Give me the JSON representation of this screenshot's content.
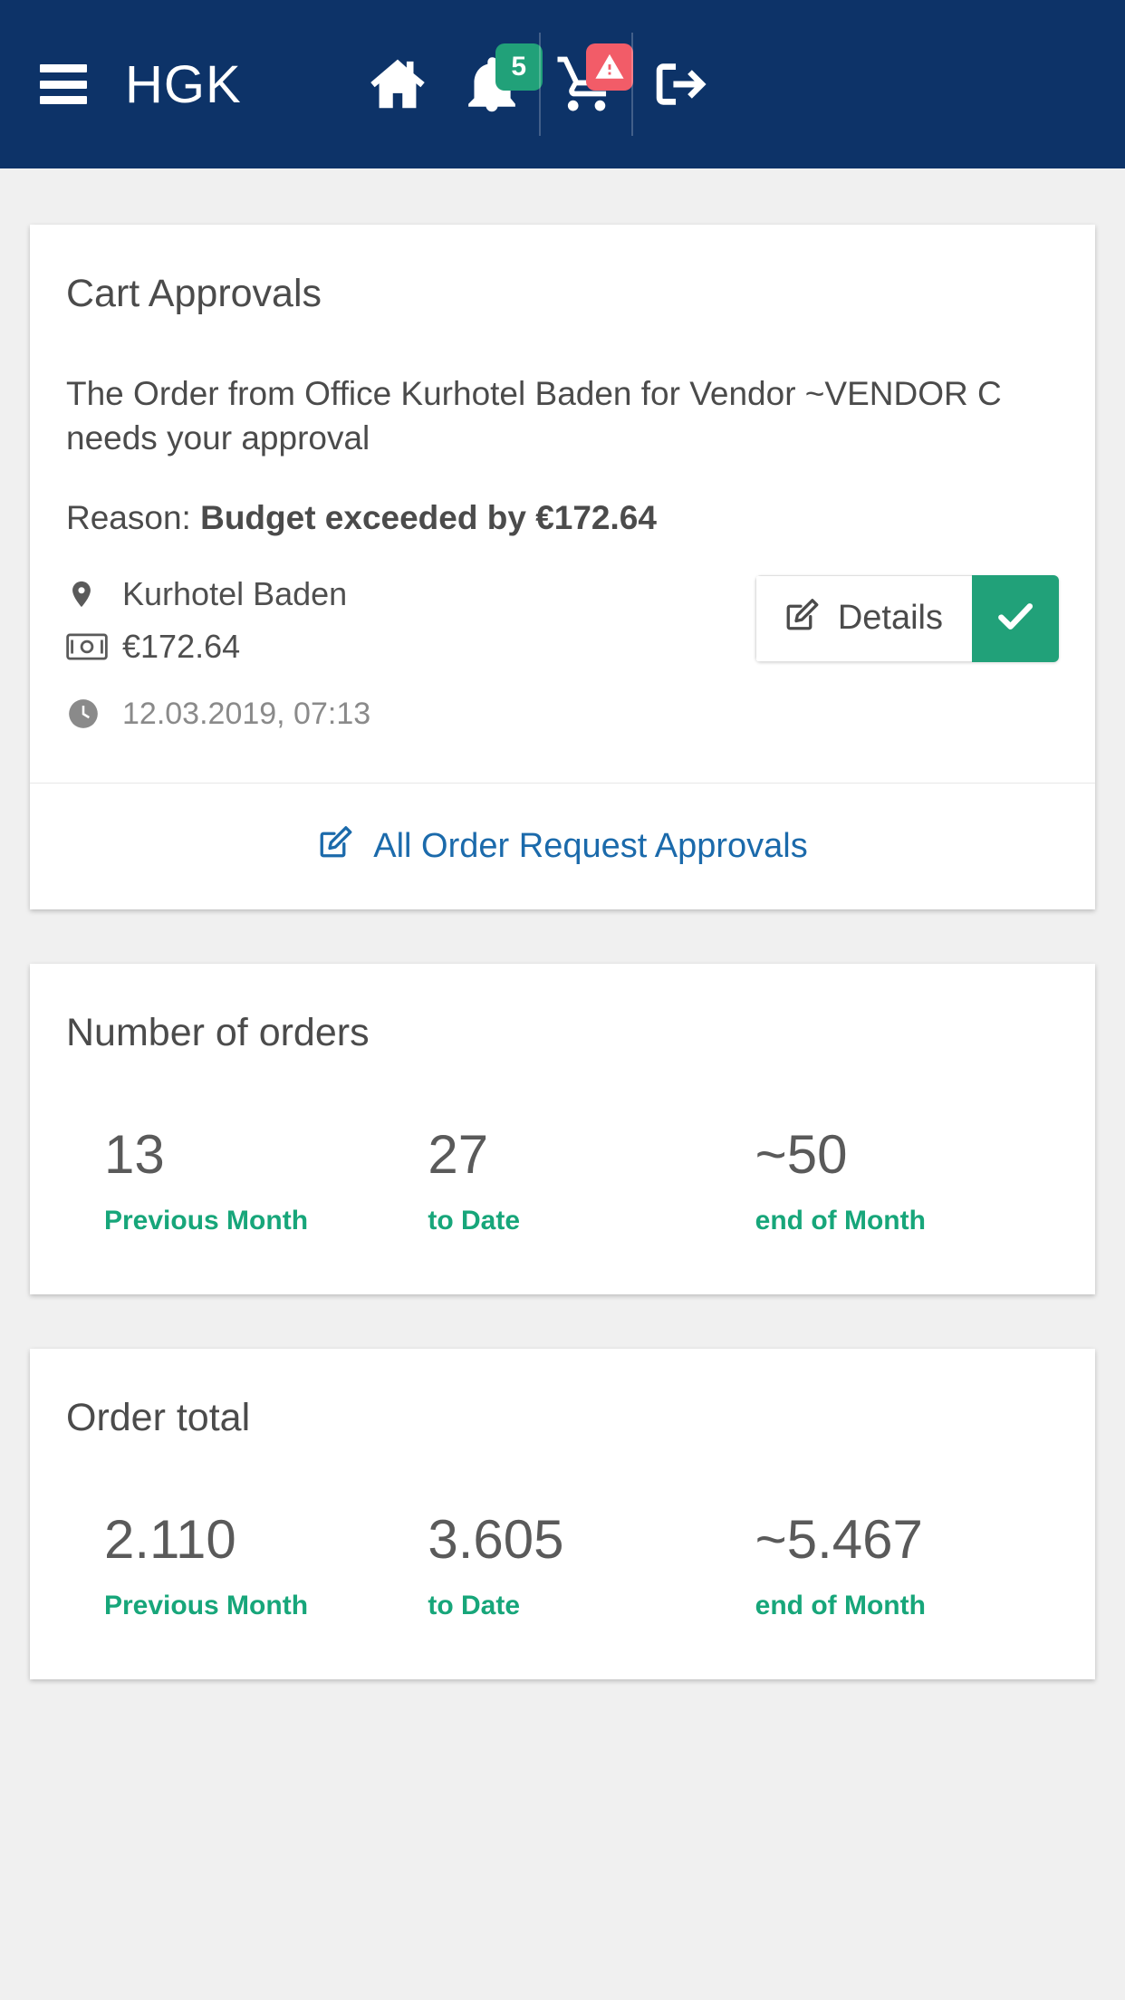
{
  "header": {
    "brand": "HGK",
    "menu_label": "menu",
    "home_label": "home",
    "notifications_count": "5",
    "cart_label": "cart",
    "cart_alert": "!",
    "logout_label": "logout"
  },
  "approvals": {
    "title": "Cart Approvals",
    "message": "The Order from Office Kurhotel Baden for Vendor ~VENDOR C needs your approval",
    "reason_label": "Reason:",
    "reason_value": "Budget exceeded by €172.64",
    "location": "Kurhotel Baden",
    "amount": "€172.64",
    "timestamp": "12.03.2019, 07:13",
    "details_button": "Details",
    "approve_button": "approve",
    "footer_link": "All Order Request Approvals"
  },
  "number_of_orders": {
    "title": "Number of orders",
    "stats": [
      {
        "value": "13",
        "label": "Previous Month"
      },
      {
        "value": "27",
        "label": "to Date"
      },
      {
        "value": "~50",
        "label": "end of Month"
      }
    ]
  },
  "order_total": {
    "title": "Order total",
    "stats": [
      {
        "value": "2.110",
        "label": "Previous Month"
      },
      {
        "value": "3.605",
        "label": "to Date"
      },
      {
        "value": "~5.467",
        "label": "end of Month"
      }
    ]
  },
  "colors": {
    "header_bg": "#0d3368",
    "accent_green": "#21a179",
    "label_green": "#17a67a",
    "alert_red": "#f25c68",
    "link_blue": "#1b6aab",
    "page_bg": "#f0f0f0"
  }
}
